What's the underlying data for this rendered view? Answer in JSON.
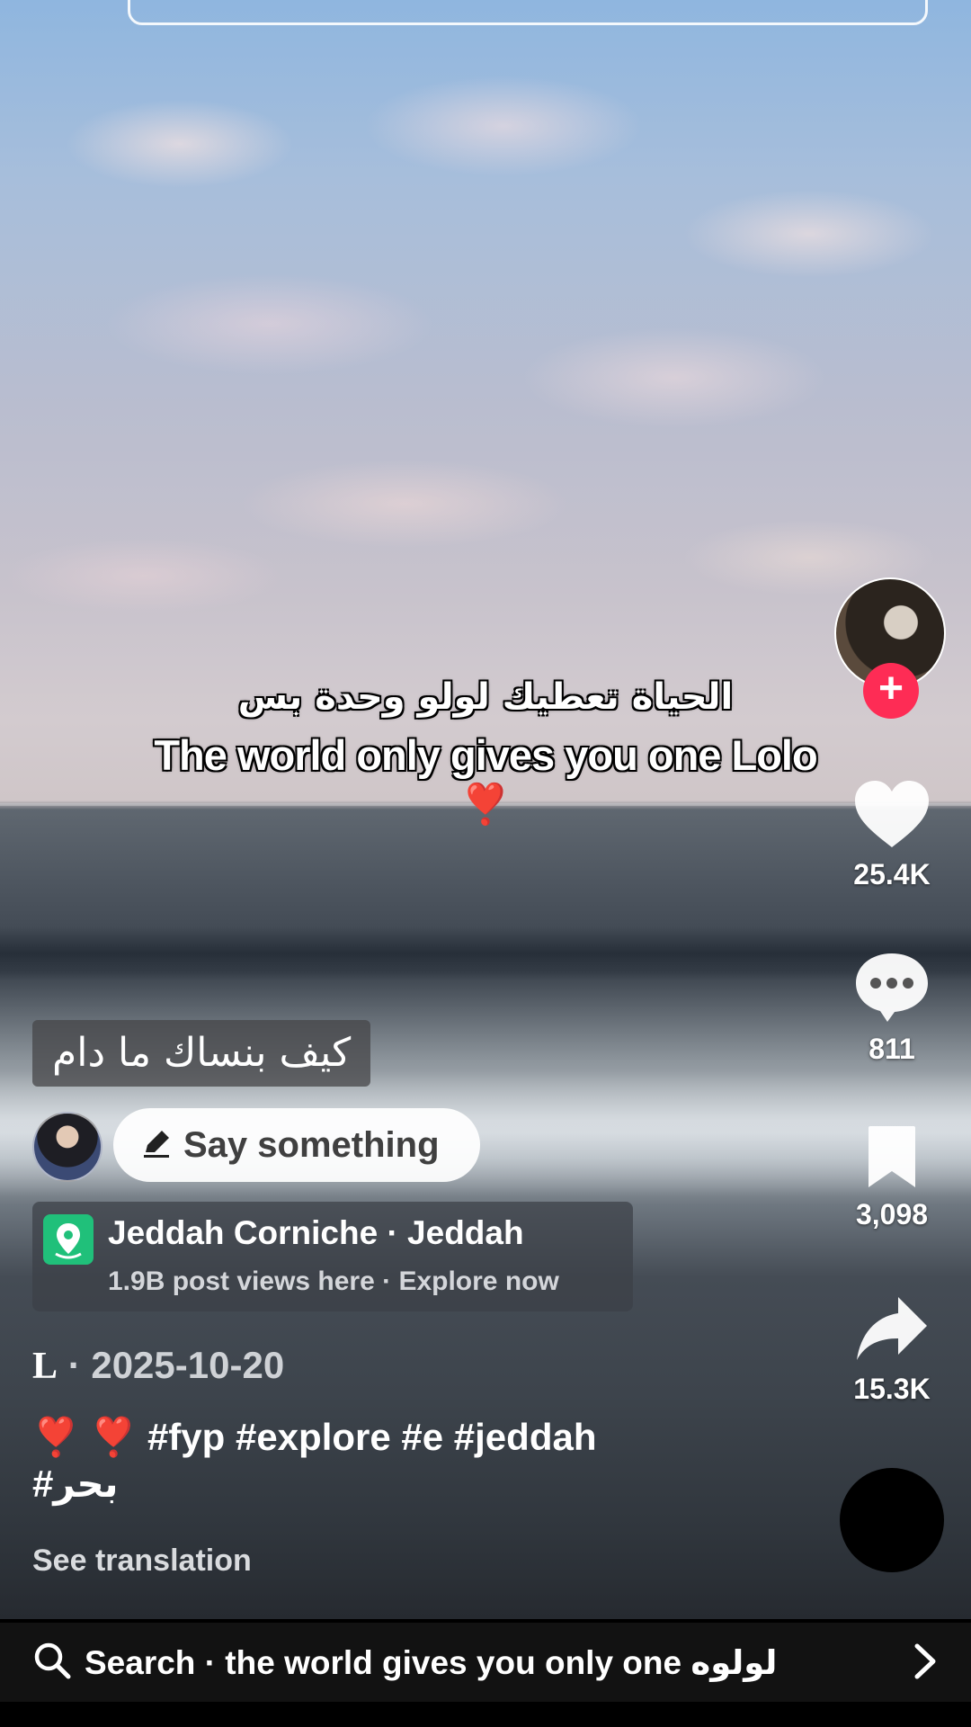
{
  "overlay": {
    "arabic_line": "الحياة تعطيك لولو وحدة بس",
    "english_line": "The world only gives you one Lolo",
    "heart": "❣️"
  },
  "rail": {
    "likes": "25.4K",
    "comments": "811",
    "saves": "3,098",
    "shares": "15.3K",
    "follow": "+"
  },
  "post": {
    "arabic_chip": "كيف بنساك ما دام",
    "say_something": "Say something",
    "location_title": "Jeddah Corniche · Jeddah",
    "location_sub": "1.9B post views here · Explore now",
    "author": "L",
    "date": "· 2025-10-20",
    "caption_hearts": "❣️ ❣️",
    "caption_tags": "#fyp #explore #e #jeddah",
    "caption_tag2": "#بحر",
    "see_translation": "See translation"
  },
  "bottom_search": {
    "text": "Search · the world gives you only one لولوه"
  },
  "colors": {
    "accent_red": "#fe2c55",
    "location_green": "#20c07a"
  }
}
